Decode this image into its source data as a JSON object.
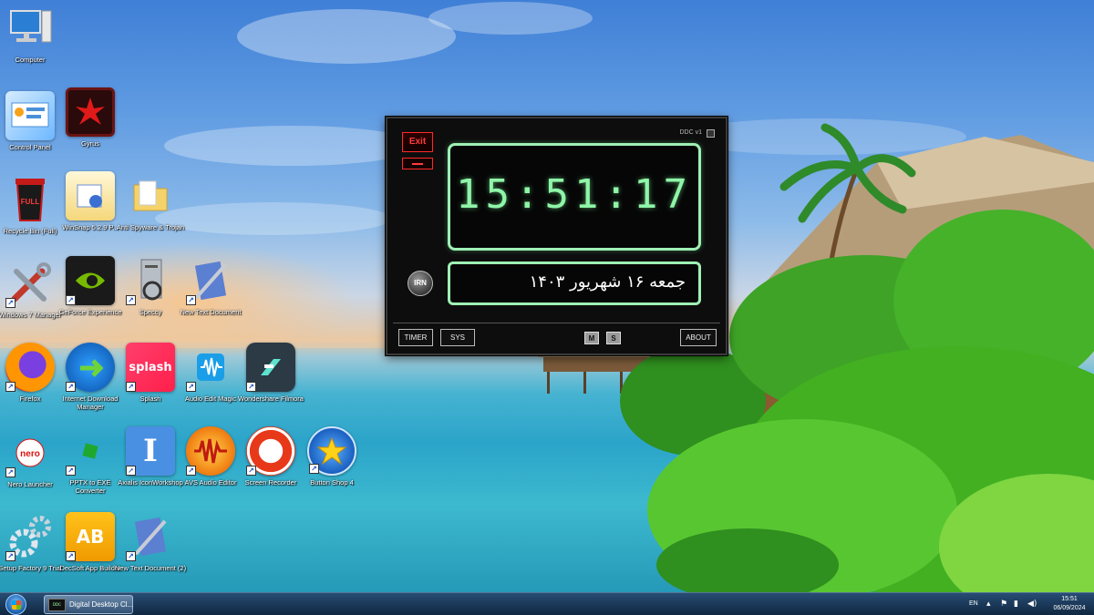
{
  "desktop": {
    "icons": [
      {
        "label": "Computer",
        "icon": "computer-icon"
      },
      {
        "label": "Control Panel",
        "icon": "control-panel-icon"
      },
      {
        "label": "Gyrus",
        "icon": "gyrus-icon"
      },
      {
        "label": "Recycle Bin (Full)",
        "icon": "recycle-bin-icon"
      },
      {
        "label": "WinSnap 5.2.9 P...",
        "icon": "winsnap-icon"
      },
      {
        "label": "Anti Spyware & Trojan",
        "icon": "folder-icon"
      },
      {
        "label": "Windows 7 Manager",
        "icon": "tools-icon"
      },
      {
        "label": "GeForce Experience",
        "icon": "nvidia-icon"
      },
      {
        "label": "Speccy",
        "icon": "speccy-icon"
      },
      {
        "label": "New Text Document",
        "icon": "notepad-icon"
      },
      {
        "label": "Firefox",
        "icon": "firefox-icon"
      },
      {
        "label": "Internet Download Manager",
        "icon": "idm-icon"
      },
      {
        "label": "Splash",
        "icon": "splash-icon"
      },
      {
        "label": "Audio Edit Magic",
        "icon": "audio-wave-icon"
      },
      {
        "label": "Wondershare Filmora",
        "icon": "filmora-icon"
      },
      {
        "label": "Nero Launcher",
        "icon": "nero-icon"
      },
      {
        "label": "PPTX to EXE Converter",
        "icon": "pptx-converter-icon"
      },
      {
        "label": "Axialis IconWorkshop",
        "icon": "iconworkshop-icon"
      },
      {
        "label": "AVS Audio Editor",
        "icon": "avs-audio-icon"
      },
      {
        "label": "Screen Recorder",
        "icon": "record-icon"
      },
      {
        "label": "Button Shop 4",
        "icon": "star-icon"
      },
      {
        "label": "Setup Factory 9 Trial",
        "icon": "gears-icon"
      },
      {
        "label": "DecSoft App Builder",
        "icon": "ab-icon"
      },
      {
        "label": "New Text Document (2)",
        "icon": "notepad-icon"
      }
    ],
    "icon_glyphs": {
      "splash": "splash",
      "nero": "nero",
      "iconworkshop": "I",
      "appbuilder": "AB"
    }
  },
  "clock": {
    "exit_label": "Exit",
    "version": "DDC v1",
    "time": "15:51:17",
    "irn_label": "IRN",
    "date": "جمعه ۱۶ شهریور ۱۴۰۳",
    "timer_label": "TIMER",
    "sys_label": "SYS",
    "m_label": "M",
    "s_label": "S",
    "about_label": "ABOUT",
    "accent_color": "#8ff5a8",
    "exit_color": "#ff3b3b"
  },
  "taskbar": {
    "task_label": "Digital Desktop Cl...",
    "task_icon_text": "DDC",
    "language": "EN",
    "time": "15:51",
    "date": "06/09/2024"
  }
}
